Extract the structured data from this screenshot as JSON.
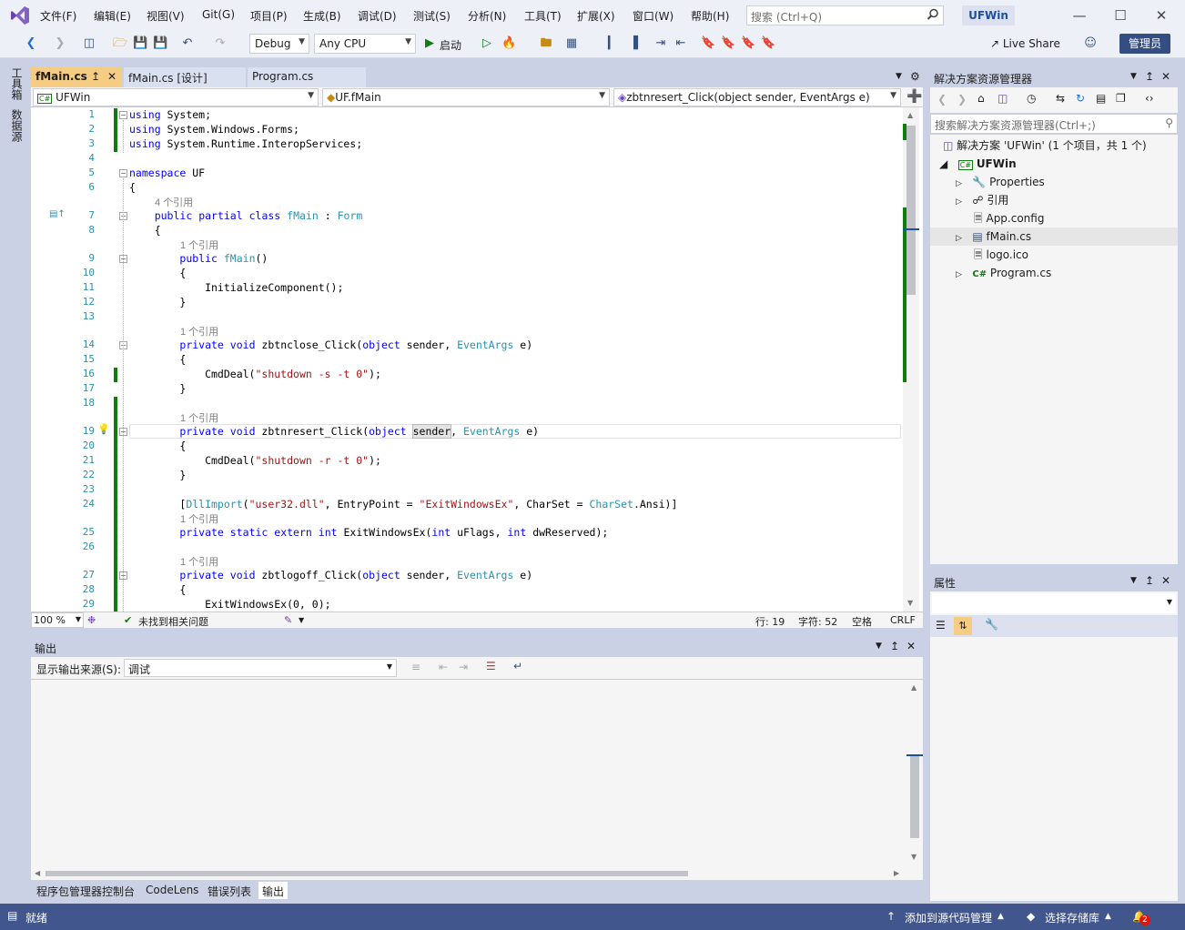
{
  "menubar": {
    "items": [
      "文件(F)",
      "编辑(E)",
      "视图(V)",
      "Git(G)",
      "项目(P)",
      "生成(B)",
      "调试(D)",
      "测试(S)",
      "分析(N)",
      "工具(T)",
      "扩展(X)",
      "窗口(W)",
      "帮助(H)"
    ],
    "search_placeholder": "搜索 (Ctrl+Q)",
    "solution_title": "UFWin"
  },
  "toolbar": {
    "config": "Debug",
    "platform": "Any CPU",
    "start_label": "启动",
    "live_share": "Live Share",
    "admin_label": "管理员"
  },
  "left_strip": {
    "toolbox": "工具箱",
    "datasources": "数据源"
  },
  "editor_tabs": [
    {
      "label": "fMain.cs",
      "active": true
    },
    {
      "label": "fMain.cs [设计]",
      "active": false
    },
    {
      "label": "Program.cs",
      "active": false
    }
  ],
  "navbar": {
    "project": "UFWin",
    "class": "UF.fMain",
    "member": "zbtnresert_Click(object sender, EventArgs e)"
  },
  "code": {
    "line_numbers": [
      "1",
      "2",
      "3",
      "4",
      "5",
      "6",
      "7",
      "8",
      "9",
      "10",
      "11",
      "12",
      "13",
      "14",
      "15",
      "16",
      "17",
      "18",
      "19",
      "20",
      "21",
      "22",
      "23",
      "24",
      "25",
      "26",
      "27",
      "28",
      "29"
    ],
    "refs_4": "4 个引用",
    "refs_1": "1 个引用"
  },
  "editor_status": {
    "zoom": "100 %",
    "issues": "未找到相关问题",
    "row": "行: 19",
    "col": "字符: 52",
    "spacing": "空格",
    "eol": "CRLF"
  },
  "output_panel": {
    "title": "输出",
    "source_label": "显示输出来源(S):",
    "source_value": "调试"
  },
  "bottom_tabs": [
    "程序包管理器控制台",
    "CodeLens",
    "错误列表",
    "输出"
  ],
  "statusbar": {
    "ready": "就绪",
    "source_control": "添加到源代码管理",
    "repo": "选择存储库",
    "notifications": "2"
  },
  "solution_explorer": {
    "title": "解决方案资源管理器",
    "search_placeholder": "搜索解决方案资源管理器(Ctrl+;)",
    "solution": "解决方案 'UFWin' (1 个项目，共 1 个)",
    "project": "UFWin",
    "items": [
      "Properties",
      "引用",
      "App.config",
      "fMain.cs",
      "logo.ico",
      "Program.cs"
    ]
  },
  "properties": {
    "title": "属性"
  },
  "colors": {
    "accent_tab": "#f5cc84",
    "statusbar": "#40568d",
    "keyword": "#0000ff",
    "type": "#2b91af",
    "string": "#a31515",
    "change_bar": "#107c10"
  }
}
